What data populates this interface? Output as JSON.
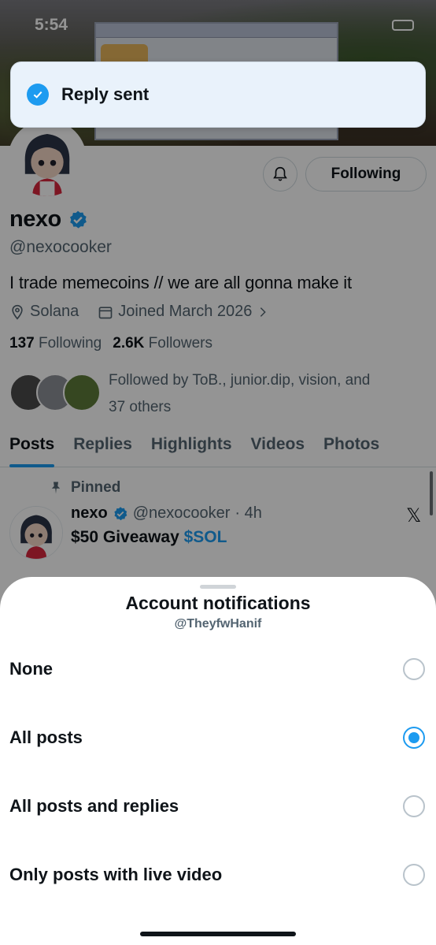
{
  "status_bar": {
    "time": "5:54"
  },
  "toast": {
    "message": "Reply sent"
  },
  "profile": {
    "name": "nexo",
    "handle": "@nexocooker",
    "bio": "I trade memecoins // we are all gonna make it",
    "location": "Solana",
    "joined": "Joined March 2026",
    "following_count": "137",
    "following_label": "Following",
    "followers_count": "2.6K",
    "followers_label": "Followers",
    "followed_by_line1": "Followed by ToB., junior.dip, vision, and",
    "followed_by_line2": "37 others",
    "follow_button_label": "Following"
  },
  "tabs": [
    {
      "label": "Posts",
      "active": true
    },
    {
      "label": "Replies",
      "active": false
    },
    {
      "label": "Highlights",
      "active": false
    },
    {
      "label": "Videos",
      "active": false
    },
    {
      "label": "Photos",
      "active": false
    }
  ],
  "pinned_post": {
    "pinned_label": "Pinned",
    "author_name": "nexo",
    "author_handle": "@nexocooker",
    "age": "· 4h",
    "text_prefix": "$50 Giveaway",
    "cashtag": "$SOL",
    "x_mark": "𝕏"
  },
  "sheet": {
    "title": "Account notifications",
    "subtitle": "@TheyfwHanif",
    "options": [
      {
        "label": "None",
        "selected": false
      },
      {
        "label": "All posts",
        "selected": true
      },
      {
        "label": "All posts and replies",
        "selected": false
      },
      {
        "label": "Only posts with live video",
        "selected": false
      }
    ]
  },
  "colors": {
    "accent": "#1d9bf0",
    "text_primary": "#0f1419",
    "text_secondary": "#536471"
  },
  "icons": [
    "check-icon",
    "bell-icon",
    "verified-badge-icon",
    "location-icon",
    "calendar-icon",
    "chevron-right-icon",
    "pin-icon",
    "x-logo-icon"
  ]
}
